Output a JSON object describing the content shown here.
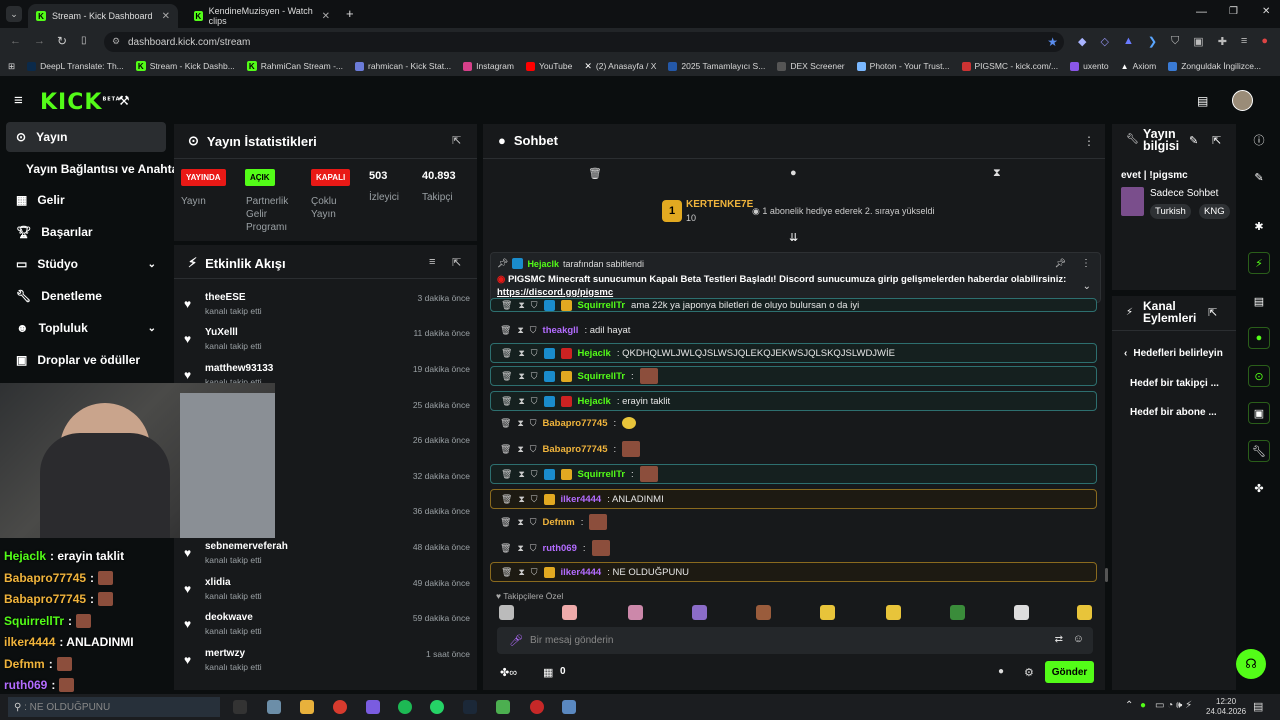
{
  "browser": {
    "tabs": [
      {
        "label": "Stream - Kick Dashboard",
        "active": true
      },
      {
        "label": "KendineMuzisyen - Watch clips",
        "active": false
      }
    ],
    "url": "dashboard.kick.com/stream",
    "bookmarks": [
      "DeepL Translate: Th...",
      "Stream - Kick Dashb...",
      "RahmiCan Stream -...",
      "rahmican - Kick Stat...",
      "Instagram",
      "YouTube",
      "(2) Anasayfa / X",
      "2025 Tamamlayıcı S...",
      "DEX Screener",
      "Photon - Your Trust...",
      "PIGSMC - kick.com/...",
      "uxento",
      "Axiom",
      "Zonguldak İngilizce..."
    ]
  },
  "header": {
    "logo": "KICK",
    "beta": "BETA"
  },
  "sidebar": {
    "items": [
      {
        "label": "Yayın"
      },
      {
        "label": "Yayın Bağlantısı ve Anahtarı"
      },
      {
        "label": "Gelir"
      },
      {
        "label": "Başarılar"
      },
      {
        "label": "Stüdyo"
      },
      {
        "label": "Denetleme"
      },
      {
        "label": "Topluluk"
      },
      {
        "label": "Droplar ve ödüller"
      }
    ]
  },
  "stats": {
    "title": "Yayın İstatistikleri",
    "live": {
      "pill": "YAYINDA",
      "label": "Yayın"
    },
    "partner": {
      "pill": "AÇIK",
      "label1": "Partnerlik",
      "label2": "Gelir",
      "label3": "Programı"
    },
    "multi": {
      "pill": "KAPALI",
      "label1": "Çoklu",
      "label2": "Yayın"
    },
    "viewers": {
      "value": "503",
      "label": "İzleyici"
    },
    "followers": {
      "value": "40.893",
      "label": "Takipçi"
    }
  },
  "activity": {
    "title": "Etkinlik Akışı",
    "events": [
      {
        "name": "theeESE",
        "sub": "kanalı takip etti",
        "time": "3 dakika önce"
      },
      {
        "name": "YuXelll",
        "sub": "kanalı takip etti",
        "time": "11 dakika önce"
      },
      {
        "name": "matthew93133",
        "sub": "kanalı takip etti",
        "time": "19 dakika önce"
      },
      {
        "name": "",
        "sub": "",
        "time": "25 dakika önce"
      },
      {
        "name": "",
        "sub": "",
        "time": "26 dakika önce"
      },
      {
        "name": "",
        "sub": "",
        "time": "32 dakika önce"
      },
      {
        "name": "",
        "sub": "",
        "time": "36 dakika önce"
      },
      {
        "name": "sebnemerveferah",
        "sub": "kanalı takip etti",
        "time": "48 dakika önce"
      },
      {
        "name": "xlidia",
        "sub": "kanalı takip etti",
        "time": "49 dakika önce"
      },
      {
        "name": "deokwave",
        "sub": "kanalı takip etti",
        "time": "59 dakika önce"
      },
      {
        "name": "mertwzy",
        "sub": "kanalı takip etti",
        "time": "1 saat önce"
      }
    ]
  },
  "chat": {
    "title": "Sohbet",
    "gift": {
      "user": "KERTENKE7E",
      "count": "10",
      "text": "1 abonelik hediye ederek 2. sıraya yükseldi"
    },
    "pinned": {
      "by": "Hejaclk",
      "by_suffix": "tarafından sabitlendi",
      "message": "PIGSMC Minecraft sunucumun Kapalı Beta Testleri Başladı! Discord sunucumuza girip gelişmelerden haberdar olabilirsiniz:",
      "link": "https://discord.gg/pigsmc"
    },
    "messages": [
      {
        "user": "SquirrellTr",
        "text": "ama 22k ya japonya biletleri de oluyo bulursan o da iyi",
        "color": "#53fc18"
      },
      {
        "user": "theakgll",
        "text": ": adil hayat",
        "color": "#b36cff"
      },
      {
        "user": "Hejaclk",
        "text": ": QKDHQLWLJWLQJSLWSJQLEKQJEKWSJQLSKQJSLWDJWİE",
        "color": "#53fc18"
      },
      {
        "user": "SquirrellTr",
        "text": ":",
        "color": "#53fc18"
      },
      {
        "user": "Hejaclk",
        "text": ": erayin taklit",
        "color": "#53fc18"
      },
      {
        "user": "Babapro77745",
        "text": ":",
        "color": "#f0b43c"
      },
      {
        "user": "Babapro77745",
        "text": ":",
        "color": "#f0b43c"
      },
      {
        "user": "SquirrellTr",
        "text": ":",
        "color": "#53fc18"
      },
      {
        "user": "ilker4444",
        "text": ": ANLADINMI",
        "color": "#b36cff"
      },
      {
        "user": "Defmm",
        "text": ":",
        "color": "#f0b43c"
      },
      {
        "user": "ruth069",
        "text": ":",
        "color": "#b36cff"
      },
      {
        "user": "ilker4444",
        "text": ": NE OLDUĞPUNU",
        "color": "#b36cff"
      }
    ],
    "emote_label": "Takipçilere Özel",
    "input_placeholder": "Bir mesaj gönderin",
    "points": "0",
    "send": "Gönder"
  },
  "stream_info": {
    "title": "Yayın bilgisi",
    "stream_title": "evet | !pigsmc",
    "category": "Sadece Sohbet",
    "tags": [
      "Turkish",
      "KNG"
    ]
  },
  "channel_actions": {
    "title1": "Kanal",
    "title2": "Eylemleri",
    "back": "Hedefleri belirleyin",
    "items": [
      "Hedef bir takipçi ...",
      "Hedef bir abone ..."
    ]
  },
  "overlay": {
    "lines": [
      {
        "user": "Hejaclk",
        "text": ": erayin taklit",
        "color": "#53fc18"
      },
      {
        "user": "Babapro77745",
        "text": ":",
        "color": "#f0b43c"
      },
      {
        "user": "Babapro77745",
        "text": ":",
        "color": "#f0b43c"
      },
      {
        "user": "SquirrellTr",
        "text": ":",
        "color": "#53fc18"
      },
      {
        "user": "ilker4444",
        "text": ": ANLADINMI",
        "color": "#f0b43c"
      },
      {
        "user": "Defmm",
        "text": ":",
        "color": "#f0b43c"
      },
      {
        "user": "ruth069",
        "text": ":",
        "color": "#b36cff"
      },
      {
        "user": "ilker4444",
        "text": ": NE OLDUĞPUNU",
        "color": "#b36cff"
      }
    ]
  },
  "taskbar": {
    "time": "12:20",
    "date": "24.04.2026"
  }
}
